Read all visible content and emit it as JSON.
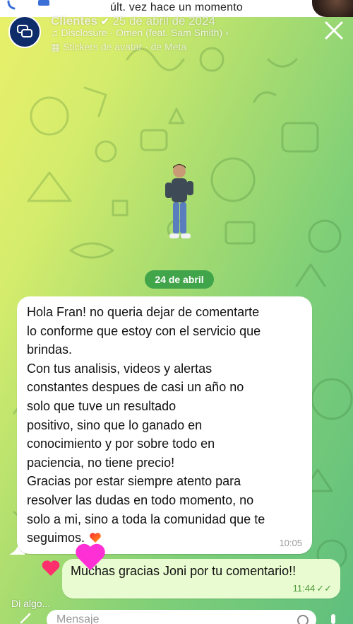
{
  "status_bar": {
    "last_seen": "últ. vez hace un momento"
  },
  "story": {
    "author": "Clientes",
    "date": "25 de abril de 2024",
    "music": "Disclosure · Omen (feat. Sam Smith)",
    "stickers": "Stickers de avatar · de Meta"
  },
  "chat": {
    "date_separator": "24 de abril",
    "incoming": {
      "text": "Hola Fran! no queria dejar de comentarte\nlo conforme que estoy con el servicio que\nbrindas.\nCon tus analisis, videos y alertas\nconstantes despues de casi un año no\nsolo que tuve un resultado\npositivo, sino que lo ganado en\nconocimiento y por sobre todo en\npaciencia, no tiene precio!\nGracias por estar siempre atento para\nresolver las dudas en todo momento, no\nsolo a mi, sino a toda la comunidad que te\nseguimos.",
      "time": "10:05"
    },
    "outgoing": {
      "text": "Muchas gracias Joni por tu comentario!!",
      "time": "11:44"
    }
  },
  "reply_hint": "Di algo...",
  "composer": {
    "placeholder": "Mensaje"
  },
  "colors": {
    "bubble_out": "#e9fbd0",
    "date_pill": "#38a046",
    "reaction_heart": "#ff3b8a"
  }
}
